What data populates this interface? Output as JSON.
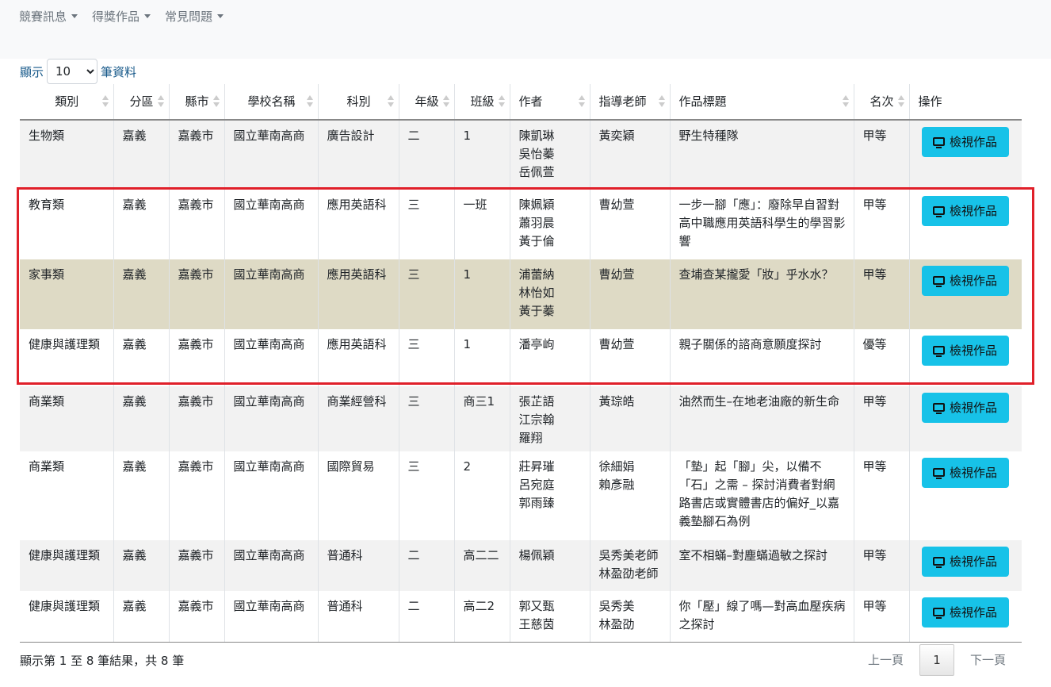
{
  "nav": {
    "items": [
      {
        "label": "競賽訊息"
      },
      {
        "label": "得獎作品"
      },
      {
        "label": "常見問題"
      }
    ]
  },
  "length_control": {
    "prefix": "顯示",
    "value": "10",
    "suffix": "筆資料"
  },
  "table": {
    "headers": [
      "類別",
      "分區",
      "縣市",
      "學校名稱",
      "科別",
      "年級",
      "班級",
      "作者",
      "指導老師",
      "作品標題",
      "名次",
      "操作"
    ],
    "view_button_label": "檢視作品",
    "rows": [
      {
        "category": "生物類",
        "region": "嘉義",
        "city": "嘉義市",
        "school": "國立華南高商",
        "dept": "廣告設計",
        "grade": "二",
        "class": "1",
        "authors": "陳凱琳\n吳怡蓁\n岳佩萱",
        "teachers": "黃奕穎",
        "title": "野生特種隊",
        "rank": "甲等"
      },
      {
        "category": "教育類",
        "region": "嘉義",
        "city": "嘉義市",
        "school": "國立華南高商",
        "dept": "應用英語科",
        "grade": "三",
        "class": "一班",
        "authors": "陳姵穎\n蕭羽晨\n黃于倫",
        "teachers": "曹幼萱",
        "title": "一步一腳「應」：廢除早自習對高中職應用英語科學生的學習影響",
        "rank": "甲等"
      },
      {
        "category": "家事類",
        "region": "嘉義",
        "city": "嘉義市",
        "school": "國立華南高商",
        "dept": "應用英語科",
        "grade": "三",
        "class": "1",
        "authors": "浦蕾納\n林怡如\n黃于蓁",
        "teachers": "曹幼萱",
        "title": "查埔查某攏愛「妝」乎水水？",
        "rank": "甲等"
      },
      {
        "category": "健康與護理類",
        "region": "嘉義",
        "city": "嘉義市",
        "school": "國立華南高商",
        "dept": "應用英語科",
        "grade": "三",
        "class": "1",
        "authors": "潘亭岣",
        "teachers": "曹幼萱",
        "title": "親子關係的諮商意願度探討",
        "rank": "優等"
      },
      {
        "category": "商業類",
        "region": "嘉義",
        "city": "嘉義市",
        "school": "國立華南高商",
        "dept": "商業經營科",
        "grade": "三",
        "class": "商三1",
        "authors": "張芷語\n江宗翰\n羅翔",
        "teachers": "黃琮皓",
        "title": "油然而生–在地老油廠的新生命",
        "rank": "甲等"
      },
      {
        "category": "商業類",
        "region": "嘉義",
        "city": "嘉義市",
        "school": "國立華南高商",
        "dept": "國際貿易",
        "grade": "三",
        "class": "2",
        "authors": "莊昇璀\n呂宛庭\n郭雨臻",
        "teachers": "徐細娟\n賴彥融",
        "title": "「墊」起「腳」尖，以備不「石」之需 – 探討消費者對網路書店或實體書店的偏好_以嘉義墊腳石為例",
        "rank": "甲等"
      },
      {
        "category": "健康與護理類",
        "region": "嘉義",
        "city": "嘉義市",
        "school": "國立華南高商",
        "dept": "普通科",
        "grade": "二",
        "class": "高二二",
        "authors": "楊佩穎",
        "teachers": "吳秀美老師\n林盈劭老師",
        "title": "室不相蟎–對塵蟎過敏之探討",
        "rank": "甲等"
      },
      {
        "category": "健康與護理類",
        "region": "嘉義",
        "city": "嘉義市",
        "school": "國立華南高商",
        "dept": "普通科",
        "grade": "二",
        "class": "高二2",
        "authors": "郭又甄\n王慈茵",
        "teachers": "吳秀美\n林盈劭",
        "title": "你「壓」線了嗎—對高血壓疾病之探討",
        "rank": "甲等"
      }
    ]
  },
  "footer": {
    "info": "顯示第 1 至 8 筆結果，共 8 筆",
    "prev": "上一頁",
    "current_page": "1",
    "next": "下一頁"
  },
  "colors": {
    "highlight_border": "#e0202a",
    "button_bg": "#17c2e8",
    "highlight_row": "#dedac5"
  }
}
